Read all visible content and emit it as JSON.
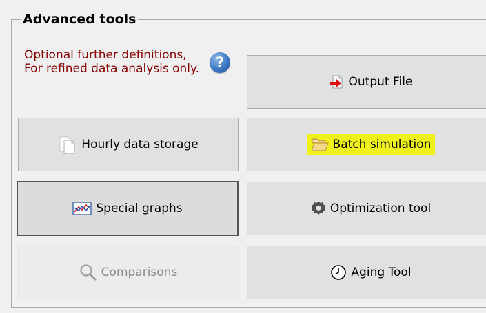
{
  "group": {
    "title": "Advanced tools"
  },
  "info": {
    "text": "Optional further definitions, For refined data analysis only."
  },
  "help": {
    "glyph": "?",
    "icon": "help-circle-icon"
  },
  "buttons": {
    "output_file": {
      "label": "Output File",
      "icon": "arrow-right-file-icon"
    },
    "hourly_storage": {
      "label": "Hourly data storage",
      "icon": "document-copy-icon"
    },
    "batch_simulation": {
      "label": "Batch simulation",
      "icon": "folder-open-icon",
      "highlight_color": "#eef21a"
    },
    "special_graphs": {
      "label": "Special graphs",
      "icon": "line-graph-icon"
    },
    "optimization_tool": {
      "label": "Optimization tool",
      "icon": "gear-icon"
    },
    "comparisons": {
      "label": "Comparisons",
      "icon": "magnifier-icon",
      "state": "disabled"
    },
    "aging_tool": {
      "label": "Aging Tool",
      "icon": "clock-icon"
    }
  },
  "colors": {
    "info_text": "#8b0000",
    "highlight": "#eef21a",
    "arrow": "#e01010"
  }
}
